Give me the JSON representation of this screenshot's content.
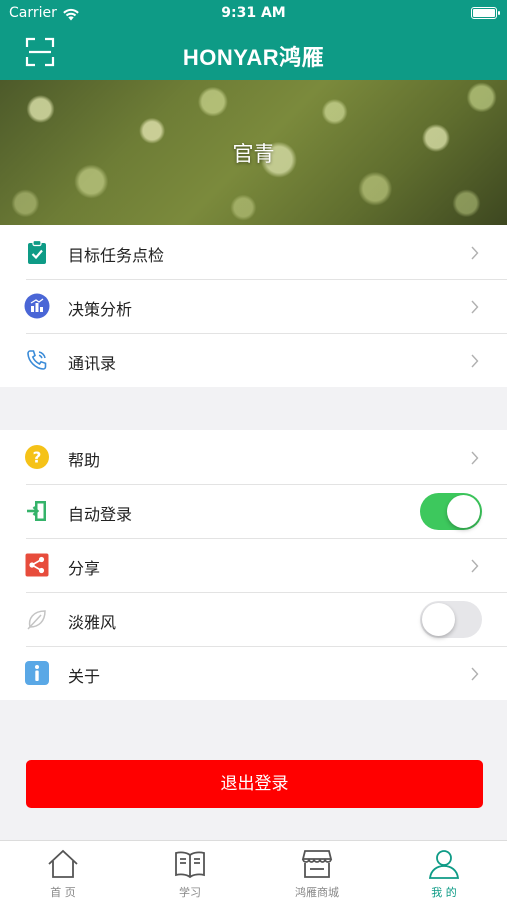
{
  "status_bar": {
    "carrier": "Carrier",
    "time": "9:31 AM"
  },
  "header": {
    "brand": "HONYAR鸿雁",
    "scan_icon": "scan-icon"
  },
  "banner": {
    "name": "官青"
  },
  "menu_group_1": [
    {
      "label": "目标任务点检",
      "icon": "clipboard-check-icon",
      "color": "#0e9b86"
    },
    {
      "label": "决策分析",
      "icon": "analytics-icon",
      "color": "#4a66d6"
    },
    {
      "label": "通讯录",
      "icon": "phone-icon",
      "color": "#3a8bd8"
    }
  ],
  "menu_group_2": [
    {
      "label": "帮助",
      "icon": "help-icon",
      "color": "#f5c218"
    },
    {
      "label": "自动登录",
      "icon": "login-icon",
      "color": "#35b36a",
      "toggle": true
    },
    {
      "label": "分享",
      "icon": "share-icon",
      "color": "#e74c3c"
    },
    {
      "label": "淡雅风",
      "icon": "leaf-icon",
      "color": "#bbbbbb",
      "toggle": false
    },
    {
      "label": "关于",
      "icon": "info-icon",
      "color": "#3a8bd8"
    }
  ],
  "logout": {
    "label": "退出登录",
    "color": "#ff0000"
  },
  "tabbar": {
    "tabs": [
      {
        "label": "首 页",
        "icon": "home-icon"
      },
      {
        "label": "学习",
        "icon": "book-icon"
      },
      {
        "label": "鸿雁商城",
        "icon": "store-icon"
      },
      {
        "label": "我 的",
        "icon": "user-icon",
        "active": true
      }
    ]
  },
  "colors": {
    "primary": "#0e9b86",
    "toggle_on": "#3dc85d",
    "danger": "#ff0000"
  }
}
